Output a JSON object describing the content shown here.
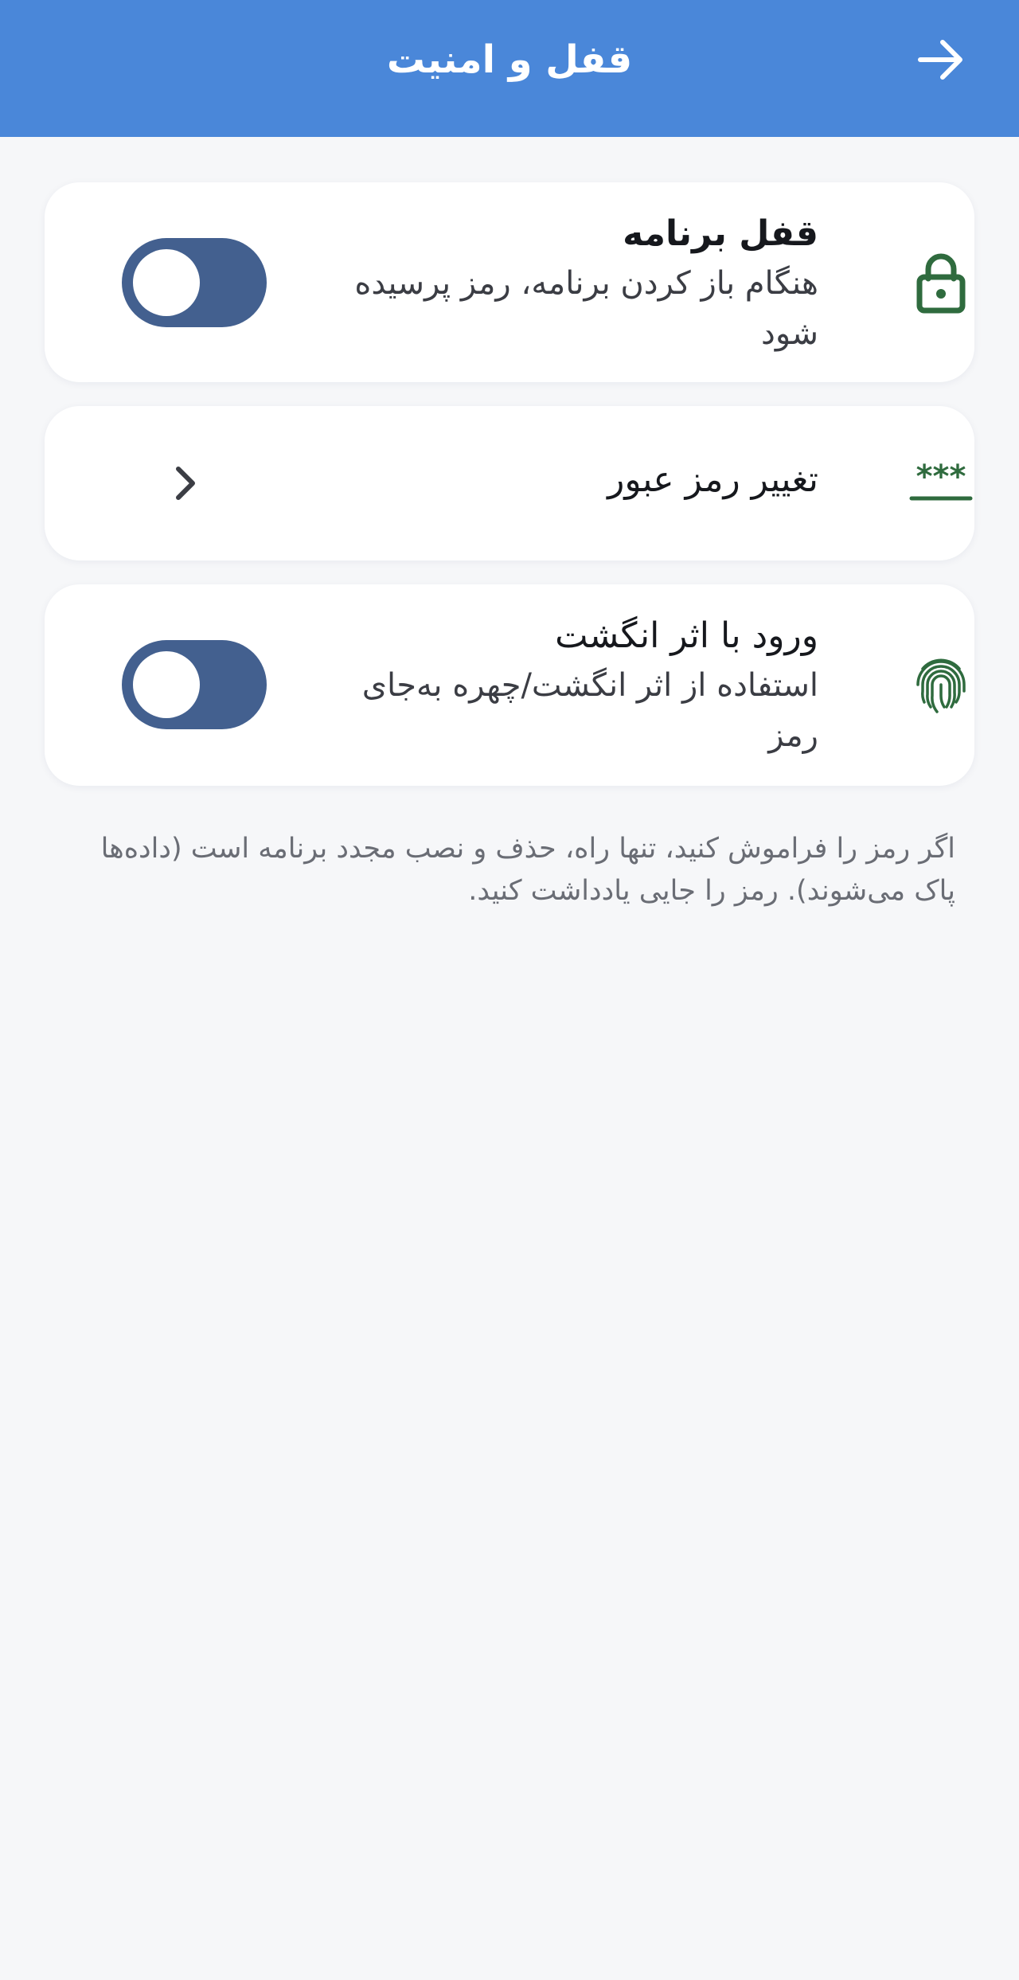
{
  "app_bar": {
    "title": "قفل و امنیت",
    "back_icon": "arrow-right-icon",
    "color": "#4a87d9"
  },
  "settings": {
    "app_lock": {
      "icon": "lock-icon",
      "title": "قفل برنامه",
      "subtitle": "هنگام باز کردن برنامه، رمز پرسیده شود",
      "enabled": false
    },
    "change_password": {
      "icon": "asterisks-icon",
      "title": "تغییر رمز عبور",
      "chevron_icon": "chevron-left-icon"
    },
    "biometric": {
      "icon": "fingerprint-icon",
      "title": "ورود با اثر انگشت",
      "subtitle": "استفاده از اثر انگشت/چهره به‌جای رمز",
      "enabled": false
    }
  },
  "footnote": "اگر رمز را فراموش کنید، تنها راه، حذف و نصب مجدد برنامه است (داده‌ها پاک می‌شوند). رمز را جایی یادداشت کنید.",
  "colors": {
    "accent": "#4a87d9",
    "icon_green": "#2f6b3e",
    "toggle": "#43608f",
    "background": "#f6f7f9"
  }
}
